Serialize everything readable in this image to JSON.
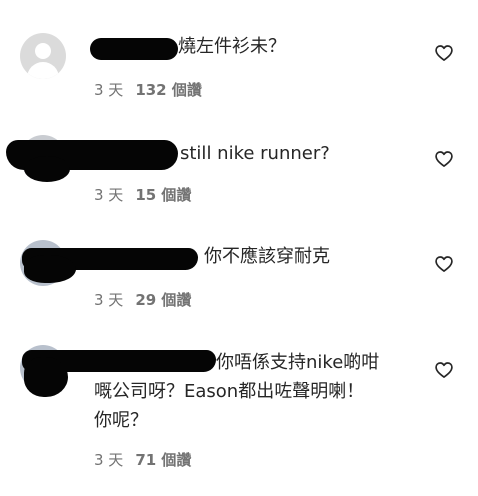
{
  "comments": [
    {
      "text": "燒左件衫未？",
      "age": "3 天",
      "likes": "132 個讚"
    },
    {
      "text": "still nike runner?",
      "age": "3 天",
      "likes": "15 個讚"
    },
    {
      "text": "你不應該穿耐克",
      "age": "3 天",
      "likes": "29 個讚"
    },
    {
      "text": "你唔係支持nike啲咁\n嘅公司呀？Eason都出咗聲明喇！\n你呢？",
      "age": "3 天",
      "likes": "71 個讚"
    }
  ],
  "icons": {
    "avatar_default": "default-avatar-icon",
    "like": "heart-outline-icon"
  }
}
